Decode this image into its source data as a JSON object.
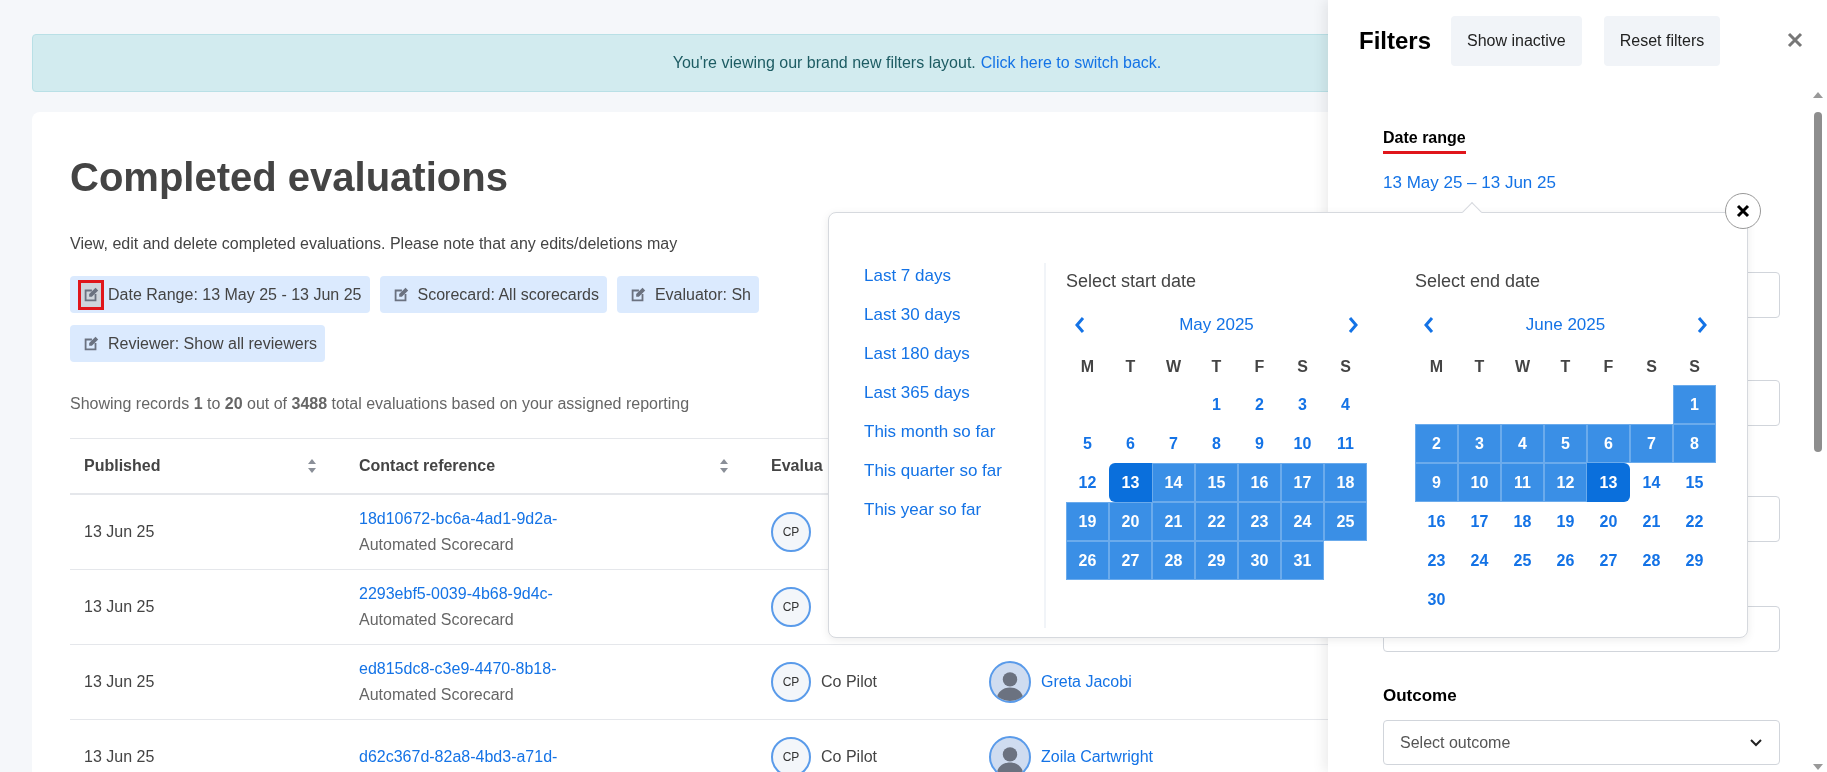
{
  "banner": {
    "text": "You're viewing our brand new filters layout.",
    "link": "Click here to switch back."
  },
  "page": {
    "title": "Completed evaluations",
    "description": "View, edit and delete completed evaluations. Please note that any edits/deletions may",
    "chips": [
      {
        "label": "Date Range: 13 May 25 - 13 Jun 25",
        "highlighted": true
      },
      {
        "label": "Scorecard: All scorecards",
        "highlighted": false
      },
      {
        "label": "Evaluator: Sh",
        "highlighted": false
      },
      {
        "label": "Reviewer: Show all reviewers",
        "highlighted": false
      }
    ],
    "summary": "Showing records **1** to **20** out of **3488** total evaluations based on your assigned reporting"
  },
  "table": {
    "columns": [
      {
        "label": "Published",
        "sortable": true
      },
      {
        "label": "Contact reference",
        "sortable": true
      },
      {
        "label": "Evalua",
        "sortable": false
      }
    ],
    "rows": [
      {
        "published": "13 Jun 25",
        "reference": "18d10672-bc6a-4ad1-9d2a-",
        "scorecard": "Automated Scorecard",
        "evaluator_initials": "CP"
      },
      {
        "published": "13 Jun 25",
        "reference": "2293ebf5-0039-4b68-9d4c-",
        "scorecard": "Automated Scorecard",
        "evaluator_initials": "CP"
      },
      {
        "published": "13 Jun 25",
        "reference": "ed815dc8-c3e9-4470-8b18-",
        "scorecard": "Automated Scorecard",
        "evaluator_initials": "CP",
        "evaluator": "Co Pilot",
        "reviewer": "Greta Jacobi"
      },
      {
        "published": "13 Jun 25",
        "reference": "d62c367d-82a8-4bd3-a71d-",
        "evaluator_initials": "CP",
        "evaluator": "Co Pilot",
        "reviewer": "Zoila Cartwright"
      }
    ]
  },
  "filters": {
    "title": "Filters",
    "buttons": [
      "Show inactive",
      "Reset filters"
    ],
    "date_range": {
      "label": "Date range",
      "value": "13 May 25 – 13 Jun 25"
    },
    "outcome": {
      "label": "Outcome",
      "placeholder": "Select outcome"
    }
  },
  "date_picker": {
    "presets": [
      "Last 7 days",
      "Last 30 days",
      "Last 180 days",
      "Last 365 days",
      "This month so far",
      "This quarter so far",
      "This year so far"
    ],
    "calendars": [
      {
        "heading": "Select start date",
        "month": "May 2025",
        "weekdays": [
          "M",
          "T",
          "W",
          "T",
          "F",
          "S",
          "S"
        ],
        "weeks": [
          [
            {
              "kind": "blank"
            },
            {
              "kind": "blank"
            },
            {
              "kind": "blank"
            },
            {
              "kind": "day",
              "day": "1",
              "in_range": false
            },
            {
              "kind": "day",
              "day": "2",
              "in_range": false
            },
            {
              "kind": "day",
              "day": "3",
              "in_range": false
            },
            {
              "kind": "day",
              "day": "4",
              "in_range": false
            }
          ],
          [
            {
              "kind": "day",
              "day": "5",
              "in_range": false
            },
            {
              "kind": "day",
              "day": "6",
              "in_range": false
            },
            {
              "kind": "day",
              "day": "7",
              "in_range": false
            },
            {
              "kind": "day",
              "day": "8",
              "in_range": false
            },
            {
              "kind": "day",
              "day": "9",
              "in_range": false
            },
            {
              "kind": "day",
              "day": "10",
              "in_range": false
            },
            {
              "kind": "day",
              "day": "11",
              "in_range": false
            }
          ],
          [
            {
              "kind": "day",
              "day": "12",
              "in_range": false
            },
            {
              "kind": "day",
              "day": "13",
              "selected": true
            },
            {
              "kind": "day",
              "day": "14",
              "in_range": true
            },
            {
              "kind": "day",
              "day": "15",
              "in_range": true
            },
            {
              "kind": "day",
              "day": "16",
              "in_range": true
            },
            {
              "kind": "day",
              "day": "17",
              "in_range": true
            },
            {
              "kind": "day",
              "day": "18",
              "in_range": true
            }
          ],
          [
            {
              "kind": "day",
              "day": "19",
              "in_range": true
            },
            {
              "kind": "day",
              "day": "20",
              "in_range": true
            },
            {
              "kind": "day",
              "day": "21",
              "in_range": true
            },
            {
              "kind": "day",
              "day": "22",
              "in_range": true
            },
            {
              "kind": "day",
              "day": "23",
              "in_range": true
            },
            {
              "kind": "day",
              "day": "24",
              "in_range": true
            },
            {
              "kind": "day",
              "day": "25",
              "in_range": true
            }
          ],
          [
            {
              "kind": "day",
              "day": "26",
              "in_range": true
            },
            {
              "kind": "day",
              "day": "27",
              "in_range": true
            },
            {
              "kind": "day",
              "day": "28",
              "in_range": true
            },
            {
              "kind": "day",
              "day": "29",
              "in_range": true
            },
            {
              "kind": "day",
              "day": "30",
              "in_range": true
            },
            {
              "kind": "day",
              "day": "31",
              "in_range": true
            },
            {
              "kind": "blank"
            }
          ]
        ]
      },
      {
        "heading": "Select end date",
        "month": "June 2025",
        "weekdays": [
          "M",
          "T",
          "W",
          "T",
          "F",
          "S",
          "S"
        ],
        "weeks": [
          [
            {
              "kind": "blank"
            },
            {
              "kind": "blank"
            },
            {
              "kind": "blank"
            },
            {
              "kind": "blank"
            },
            {
              "kind": "blank"
            },
            {
              "kind": "blank"
            },
            {
              "kind": "day",
              "day": "1",
              "in_range": true
            }
          ],
          [
            {
              "kind": "day",
              "day": "2",
              "in_range": true
            },
            {
              "kind": "day",
              "day": "3",
              "in_range": true
            },
            {
              "kind": "day",
              "day": "4",
              "in_range": true
            },
            {
              "kind": "day",
              "day": "5",
              "in_range": true
            },
            {
              "kind": "day",
              "day": "6",
              "in_range": true
            },
            {
              "kind": "day",
              "day": "7",
              "in_range": true
            },
            {
              "kind": "day",
              "day": "8",
              "in_range": true
            }
          ],
          [
            {
              "kind": "day",
              "day": "9",
              "in_range": true
            },
            {
              "kind": "day",
              "day": "10",
              "in_range": true
            },
            {
              "kind": "day",
              "day": "11",
              "in_range": true
            },
            {
              "kind": "day",
              "day": "12",
              "in_range": true
            },
            {
              "kind": "day",
              "day": "13",
              "selected": true
            },
            {
              "kind": "day",
              "day": "14",
              "in_range": false
            },
            {
              "kind": "day",
              "day": "15",
              "in_range": false
            }
          ],
          [
            {
              "kind": "day",
              "day": "16",
              "in_range": false
            },
            {
              "kind": "day",
              "day": "17",
              "in_range": false
            },
            {
              "kind": "day",
              "day": "18",
              "in_range": false
            },
            {
              "kind": "day",
              "day": "19",
              "in_range": false
            },
            {
              "kind": "day",
              "day": "20",
              "in_range": false
            },
            {
              "kind": "day",
              "day": "21",
              "in_range": false
            },
            {
              "kind": "day",
              "day": "22",
              "in_range": false
            }
          ],
          [
            {
              "kind": "day",
              "day": "23",
              "in_range": false
            },
            {
              "kind": "day",
              "day": "24",
              "in_range": false
            },
            {
              "kind": "day",
              "day": "25",
              "in_range": false
            },
            {
              "kind": "day",
              "day": "26",
              "in_range": false
            },
            {
              "kind": "day",
              "day": "27",
              "in_range": false
            },
            {
              "kind": "day",
              "day": "28",
              "in_range": false
            },
            {
              "kind": "day",
              "day": "29",
              "in_range": false
            }
          ],
          [
            {
              "kind": "day",
              "day": "30",
              "in_range": false
            }
          ]
        ]
      }
    ]
  }
}
